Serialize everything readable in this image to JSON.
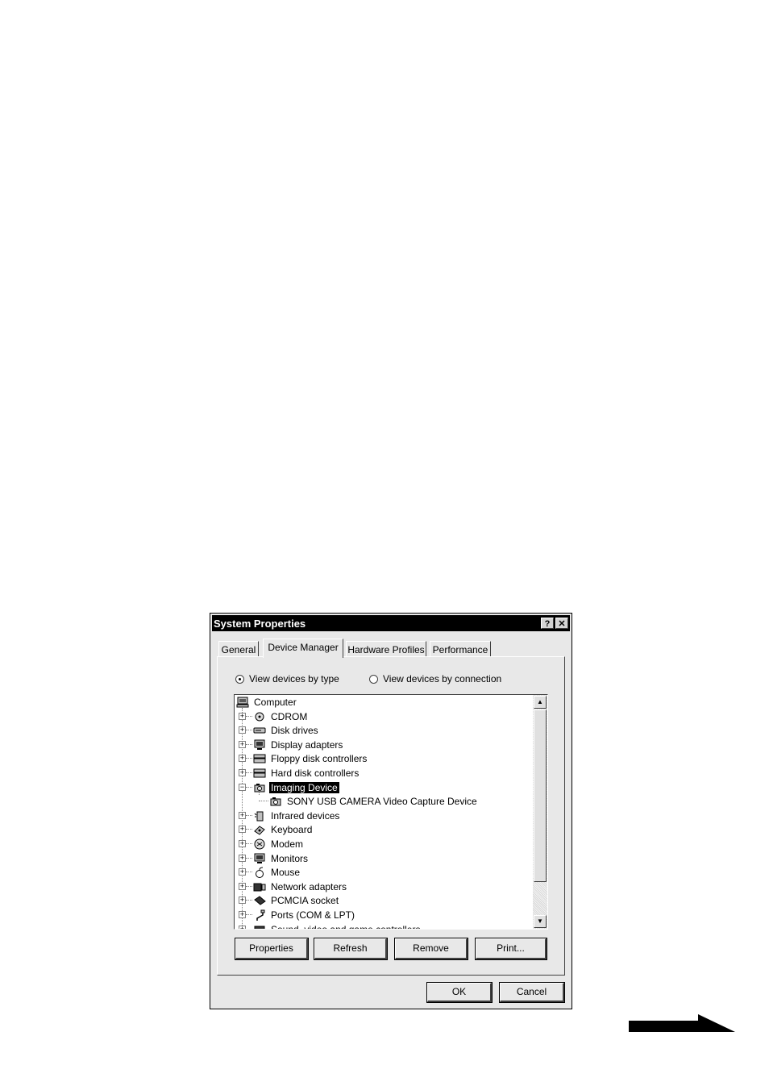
{
  "window": {
    "title": "System Properties",
    "help_glyph": "?",
    "close_glyph": "✕"
  },
  "tabs": [
    {
      "label": "General",
      "active": false
    },
    {
      "label": "Device Manager",
      "active": true
    },
    {
      "label": "Hardware Profiles",
      "active": false
    },
    {
      "label": "Performance",
      "active": false
    }
  ],
  "view_options": {
    "by_type": {
      "label": "View devices by type",
      "selected": true
    },
    "by_connection": {
      "label": "View devices by connection",
      "selected": false
    }
  },
  "tree": {
    "root": {
      "label": "Computer",
      "icon": "computer-icon"
    },
    "items": [
      {
        "label": "CDROM",
        "icon": "cdrom-icon",
        "expander": "+"
      },
      {
        "label": "Disk drives",
        "icon": "disk-drive-icon",
        "expander": "+"
      },
      {
        "label": "Display adapters",
        "icon": "display-adapter-icon",
        "expander": "+"
      },
      {
        "label": "Floppy disk controllers",
        "icon": "floppy-controller-icon",
        "expander": "+"
      },
      {
        "label": "Hard disk controllers",
        "icon": "hard-disk-controller-icon",
        "expander": "+"
      },
      {
        "label": "Imaging Device",
        "icon": "imaging-device-icon",
        "expander": "−",
        "selected": true
      },
      {
        "label": "SONY USB CAMERA Video Capture Device",
        "icon": "camera-icon",
        "child": true
      },
      {
        "label": "Infrared devices",
        "icon": "infrared-icon",
        "expander": "+"
      },
      {
        "label": "Keyboard",
        "icon": "keyboard-icon",
        "expander": "+"
      },
      {
        "label": "Modem",
        "icon": "modem-icon",
        "expander": "+"
      },
      {
        "label": "Monitors",
        "icon": "monitor-icon",
        "expander": "+"
      },
      {
        "label": "Mouse",
        "icon": "mouse-icon",
        "expander": "+"
      },
      {
        "label": "Network adapters",
        "icon": "network-adapter-icon",
        "expander": "+"
      },
      {
        "label": "PCMCIA socket",
        "icon": "pcmcia-icon",
        "expander": "+"
      },
      {
        "label": "Ports (COM & LPT)",
        "icon": "ports-icon",
        "expander": "+"
      },
      {
        "label": "Sound, video and game controllers",
        "icon": "sound-icon",
        "expander": "+"
      }
    ]
  },
  "scrollbar": {
    "up_glyph": "▲",
    "down_glyph": "▼"
  },
  "panel_buttons": {
    "properties": "Properties",
    "refresh": "Refresh",
    "remove": "Remove",
    "print": "Print..."
  },
  "dialog_buttons": {
    "ok": "OK",
    "cancel": "Cancel"
  },
  "page_decoration": {
    "icon": "arrow-right-icon"
  }
}
